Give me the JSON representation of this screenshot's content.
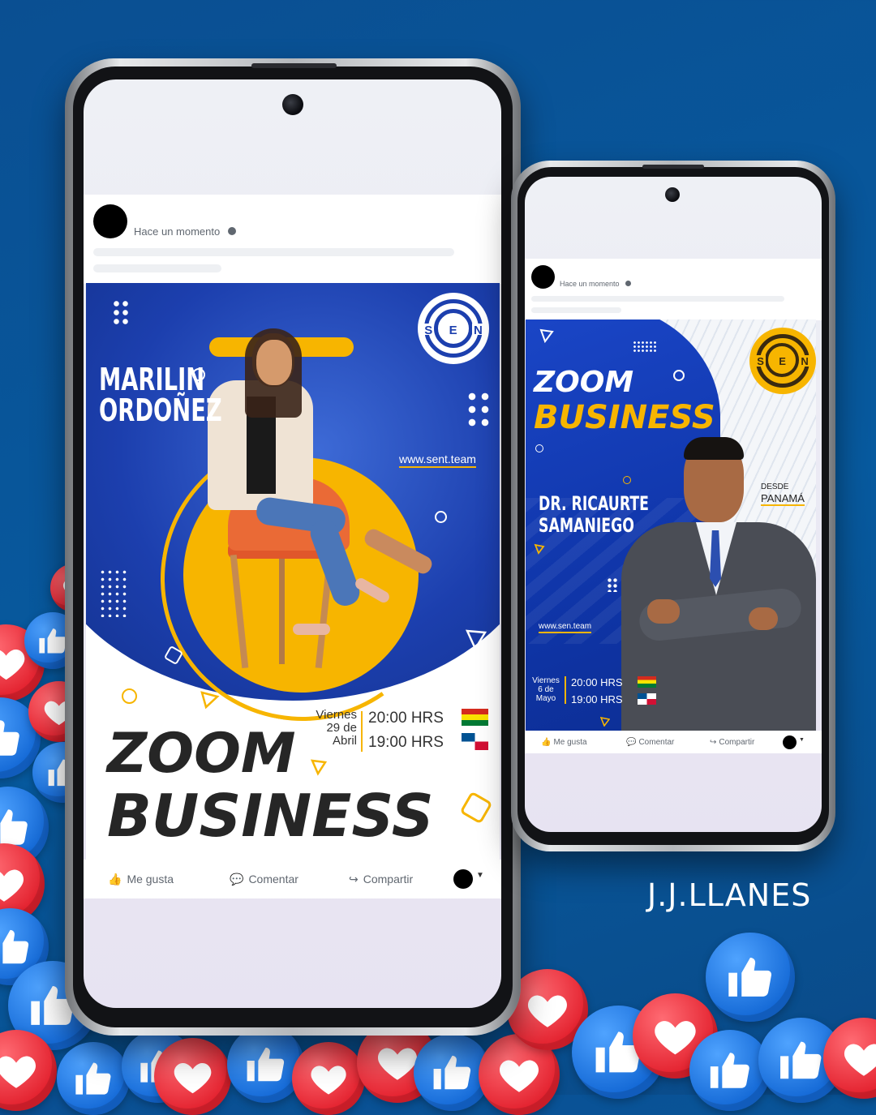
{
  "brand": {
    "signature": "J.J.LLANES"
  },
  "colors": {
    "background": "#0a4f92",
    "accent_yellow": "#f7b500",
    "deep_blue": "#123a9e",
    "like_blue": "#1469d6",
    "love_red": "#e3212e"
  },
  "phone_left": {
    "post_header": {
      "time": "Hace un momento",
      "globe_icon": "globe-icon"
    },
    "flyer": {
      "speaker_name_line1": "MARILIN",
      "speaker_name_line2": "ORDOÑEZ",
      "logo_letters": [
        "S",
        "E",
        "N"
      ],
      "website": "www.sent.team",
      "day_line1": "Viernes",
      "day_line2": "29 de",
      "day_line3": "Abril",
      "time_1": "20:00 HRS",
      "time_2": "19:00 HRS",
      "title_line1": "ZOOM",
      "title_line2": "BUSINESS"
    },
    "actions": {
      "like": "Me gusta",
      "comment": "Comentar",
      "share": "Compartir"
    }
  },
  "phone_right": {
    "post_header": {
      "time": "Hace un momento",
      "globe_icon": "globe-icon"
    },
    "flyer": {
      "title_line1": "ZOOM",
      "title_line2": "BUSINESS",
      "logo_letters": [
        "S",
        "E",
        "N"
      ],
      "from_label": "DESDE",
      "from_place": "PANAMÁ",
      "speaker_name_line1": "DR. RICAURTE",
      "speaker_name_line2": "SAMANIEGO",
      "website": "www.sen.team",
      "day_line1": "Viernes",
      "day_line2": "6 de",
      "day_line3": "Mayo",
      "time_1": "20:00 HRS",
      "time_2": "19:00 HRS"
    },
    "actions": {
      "like": "Me gusta",
      "comment": "Comentar",
      "share": "Compartir"
    }
  }
}
